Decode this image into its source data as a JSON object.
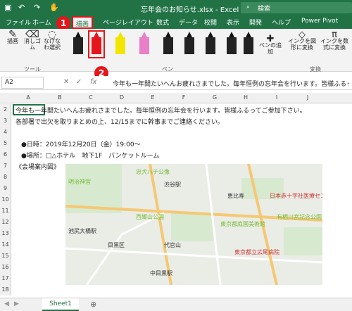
{
  "titlebar": {
    "title": "忘年会のお知らせ.xlsx - Excel",
    "search": "検索"
  },
  "tabs": [
    "ファイル",
    "ホーム",
    "描画",
    "ページレイアウト",
    "数式",
    "データ",
    "校閲",
    "表示",
    "開発",
    "ヘルプ",
    "Power Pivot"
  ],
  "ribbon": {
    "draw_label": "描画",
    "eraser_label": "消しゴム",
    "lasso_label": "なげなわ選択",
    "tools_group": "ツール",
    "pens_group": "ペン",
    "add_pen": "ペンの追加",
    "ink_to_shape": "インクを図形に変換",
    "ink_to_math": "インクを数式に変換",
    "convert_group": "変換"
  },
  "formula": {
    "cell_ref": "A2",
    "text": "今年も一年間たいへんお疲れさまでした。毎年恒例の忘年会を行います。皆様ふるって"
  },
  "columns": [
    "A",
    "B",
    "C",
    "D",
    "E",
    "F",
    "G",
    "H",
    "I",
    "J"
  ],
  "rows": [
    "2",
    "3",
    "4",
    "5",
    "6",
    "7",
    "8",
    "9",
    "10",
    "11",
    "12",
    "13",
    "14",
    "15",
    "16",
    "17",
    "18"
  ],
  "cells": {
    "a2": "今年も一年間たいへんお疲れさまでした。毎年恒例の忘年会を行います。皆様ふるってご参加下さい。",
    "a3": "各部署で出欠を取りまとめの上、12/15までに幹事までご連絡ください。",
    "a5": "●日時：2019年12月20日（金）19:00～",
    "a6": "●場所：□△ホテル　地下1F　バンケットルーム",
    "a7": "《会場案内図》"
  },
  "map_labels": [
    "忠犬ハチ公像",
    "渋谷駅",
    "明治神宮",
    "恵比寿",
    "目黒区",
    "代官山",
    "中目黒駅",
    "池尻大橋駅",
    "西郷山公園",
    "東京都庭園美術館",
    "日本赤十字社医療センター",
    "有栖川宮記念公園",
    "東京都立広尾病院"
  ],
  "sheet": {
    "tab": "Sheet1"
  },
  "annotations": {
    "one": "1",
    "two": "2"
  },
  "pen_colors": [
    "#111111",
    "#e4161b",
    "#f2e600",
    "#e87fc7",
    "#111111",
    "#111111",
    "#111111",
    "#111111",
    "#111111",
    "#111111"
  ]
}
